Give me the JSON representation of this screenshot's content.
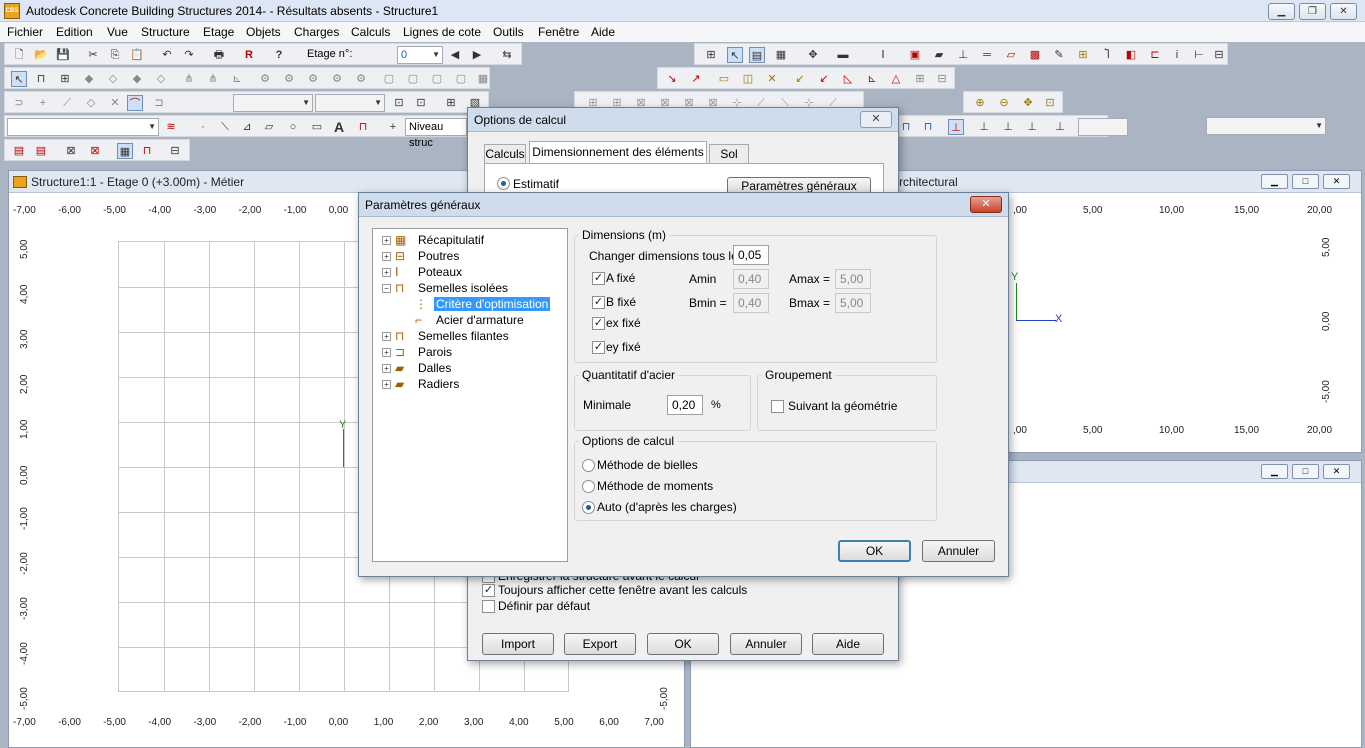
{
  "app": {
    "title": "Autodesk Concrete Building Structures 2014- - Résultats absents - Structure1",
    "icon_text": "CBS"
  },
  "menu": [
    "Fichier",
    "Edition",
    "Vue",
    "Structure",
    "Etage",
    "Objets",
    "Charges",
    "Calculs",
    "Lignes de cote",
    "Outils",
    "Fenêtre",
    "Aide"
  ],
  "toolbar": {
    "etage_label": "Etage n°:",
    "etage_value": "0",
    "niveau_label": "Niveau struc"
  },
  "mdi_left": {
    "title": "Structure1:1 - Etage 0 (+3.00m) - Métier",
    "x_ticks": [
      "-7,00",
      "-6,00",
      "-5,00",
      "-4,00",
      "-3,00",
      "-2,00",
      "-1,00",
      "0,00",
      "1,00",
      "2,00",
      "3,00",
      "4,00",
      "5,00",
      "6,00",
      "7,00"
    ],
    "y_ticks": [
      "5,00",
      "4,00",
      "3,00",
      "2,00",
      "1,00",
      "0,00",
      "-1,00",
      "-2,00",
      "-3,00",
      "-4,00",
      "-5,00"
    ],
    "axis_y": "Y"
  },
  "mdi_right_top": {
    "title": "rchitectural",
    "x_ticks": [
      ",00",
      "5,00",
      "10,00",
      "15,00",
      "20,00"
    ],
    "y_ticks": [
      "5,00",
      "0,00",
      "-5,00"
    ],
    "axis_x": "X",
    "axis_y": "Y"
  },
  "options_dialog": {
    "title": "Options de calcul",
    "tabs": [
      "Calculs",
      "Dimensionnement des éléments BA",
      "Sol"
    ],
    "radio_estimatif": "Estimatif",
    "params_button": "Paramètres généraux",
    "check_save": "Enregistrer la structure avant le calcul",
    "check_always": "Toujours afficher cette fenêtre avant les calculs",
    "check_default": "Définir par défaut",
    "buttons": [
      "Import",
      "Export",
      "OK",
      "Annuler",
      "Aide"
    ]
  },
  "params_dialog": {
    "title": "Paramètres généraux",
    "tree": [
      {
        "label": "Récapitulatif",
        "level": 0,
        "expander": "+",
        "icon": "table-icon"
      },
      {
        "label": "Poutres",
        "level": 0,
        "expander": "+",
        "icon": "beam-icon"
      },
      {
        "label": "Poteaux",
        "level": 0,
        "expander": "+",
        "icon": "column-icon"
      },
      {
        "label": "Semelles isolées",
        "level": 0,
        "expander": "-",
        "icon": "footing-icon"
      },
      {
        "label": "Critère d'optimisation",
        "level": 1,
        "selected": true,
        "icon": "criteria-icon"
      },
      {
        "label": "Acier d'armature",
        "level": 1,
        "icon": "rebar-icon"
      },
      {
        "label": "Semelles filantes",
        "level": 0,
        "expander": "+",
        "icon": "strip-footing-icon"
      },
      {
        "label": "Parois",
        "level": 0,
        "expander": "+",
        "icon": "wall-icon"
      },
      {
        "label": "Dalles",
        "level": 0,
        "expander": "+",
        "icon": "slab-icon"
      },
      {
        "label": "Radiers",
        "level": 0,
        "expander": "+",
        "icon": "raft-icon"
      }
    ],
    "dimensions": {
      "group_label": "Dimensions (m)",
      "change_label": "Changer dimensions tous les",
      "change_value": "0,05",
      "a_fixed": "A fixé",
      "b_fixed": "B fixé",
      "ex_fixed": "ex fixé",
      "ey_fixed": "ey fixé",
      "amin_label": "Amin",
      "amin_value": "0,40",
      "amax_label": "Amax =",
      "amax_value": "5,00",
      "bmin_label": "Bmin =",
      "bmin_value": "0,40",
      "bmax_label": "Bmax =",
      "bmax_value": "5,00"
    },
    "acier": {
      "group_label": "Quantitatif d'acier",
      "min_label": "Minimale",
      "min_value": "0,20",
      "unit": "%"
    },
    "groupement": {
      "group_label": "Groupement",
      "check_label": "Suivant la géométrie"
    },
    "options": {
      "group_label": "Options de calcul",
      "radios": [
        "Méthode de bielles",
        "Méthode de moments",
        "Auto (d'après les charges)"
      ],
      "selected_index": 2
    },
    "ok": "OK",
    "cancel": "Annuler"
  }
}
